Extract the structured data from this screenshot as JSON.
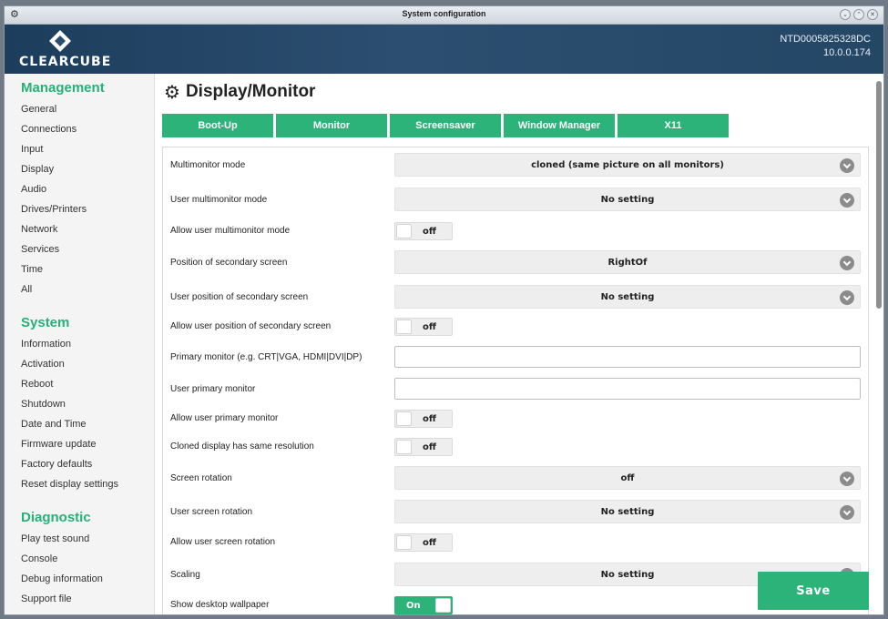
{
  "window": {
    "title": "System configuration"
  },
  "header": {
    "logo_text": "CLEARCUBE",
    "device_id": "NTD0005825328DC",
    "ip": "10.0.0.174"
  },
  "sidebar": {
    "sections": [
      {
        "title": "Management",
        "items": [
          "General",
          "Connections",
          "Input",
          "Display",
          "Audio",
          "Drives/Printers",
          "Network",
          "Services",
          "Time",
          "All"
        ]
      },
      {
        "title": "System",
        "items": [
          "Information",
          "Activation",
          "Reboot",
          "Shutdown",
          "Date and Time",
          "Firmware update",
          "Factory defaults",
          "Reset display settings"
        ]
      },
      {
        "title": "Diagnostic",
        "items": [
          "Play test sound",
          "Console",
          "Debug information",
          "Support file"
        ]
      }
    ]
  },
  "page": {
    "title": "Display/Monitor"
  },
  "tabs": [
    "Boot-Up",
    "Monitor",
    "Screensaver",
    "Window Manager",
    "X11"
  ],
  "settings": [
    {
      "label": "Multimonitor mode",
      "type": "select",
      "value": "cloned (same picture on all monitors)"
    },
    {
      "label": "User multimonitor mode",
      "type": "select",
      "value": "No setting"
    },
    {
      "label": "Allow user multimonitor mode",
      "type": "toggle",
      "value": "off"
    },
    {
      "label": "Position of secondary screen",
      "type": "select",
      "value": "RightOf"
    },
    {
      "label": "User position of secondary screen",
      "type": "select",
      "value": "No setting"
    },
    {
      "label": "Allow user position of secondary screen",
      "type": "toggle",
      "value": "off"
    },
    {
      "label": "Primary monitor (e.g. CRT|VGA, HDMI|DVI|DP)",
      "type": "text",
      "value": ""
    },
    {
      "label": "User primary monitor",
      "type": "text",
      "value": ""
    },
    {
      "label": "Allow user primary monitor",
      "type": "toggle",
      "value": "off"
    },
    {
      "label": "Cloned display has same resolution",
      "type": "toggle",
      "value": "off"
    },
    {
      "label": "Screen rotation",
      "type": "select",
      "value": "off"
    },
    {
      "label": "User screen rotation",
      "type": "select",
      "value": "No setting"
    },
    {
      "label": "Allow user screen rotation",
      "type": "toggle",
      "value": "off"
    },
    {
      "label": "Scaling",
      "type": "select",
      "value": "No setting"
    },
    {
      "label": "Show desktop wallpaper",
      "type": "toggle",
      "value": "On"
    }
  ],
  "save_label": "Save",
  "colors": {
    "accent": "#2bb37a",
    "header": "#254766"
  }
}
